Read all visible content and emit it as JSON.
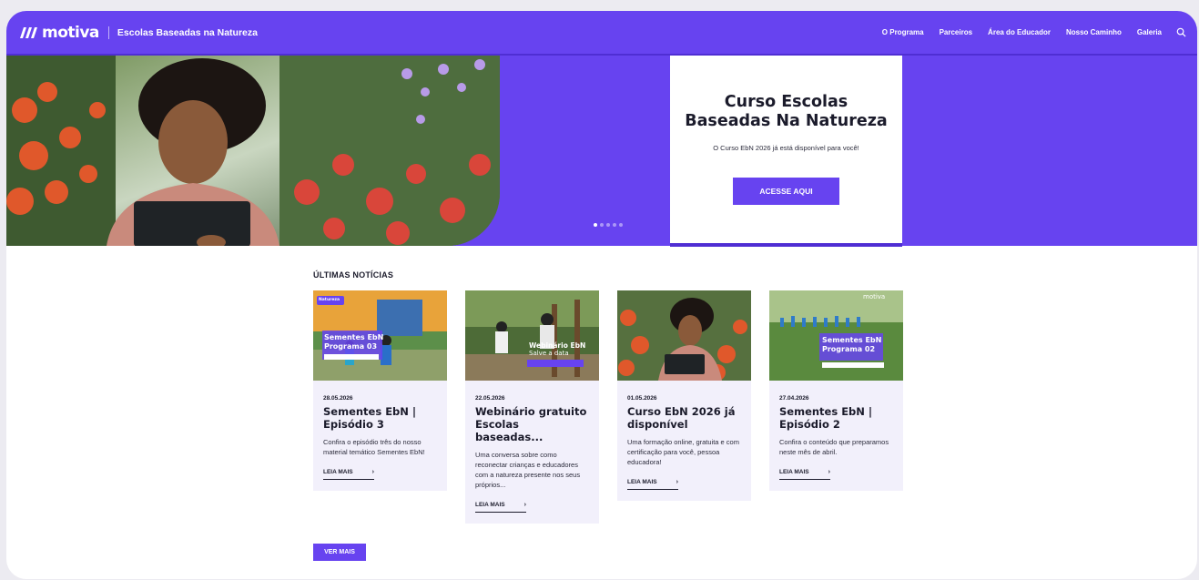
{
  "brand": {
    "logo_text": "motiva",
    "site_name": "Escolas Baseadas na Natureza",
    "accent_color": "#6743f0"
  },
  "nav": {
    "items": [
      {
        "label": "O Programa"
      },
      {
        "label": "Parceiros"
      },
      {
        "label": "Área do Educador"
      },
      {
        "label": "Nosso Caminho"
      },
      {
        "label": "Galeria"
      }
    ],
    "search_icon": "search-icon"
  },
  "hero": {
    "title": "Curso Escolas Baseadas Na Natureza",
    "subtitle": "O Curso EbN 2026 já está disponível para você!",
    "cta_label": "ACESSE AQUI",
    "slide_count": 5,
    "active_slide": 1
  },
  "news": {
    "heading_bold": "ÚLTIMAS",
    "heading_rest": " NOTÍCIAS",
    "items": [
      {
        "date": "28.05.2026",
        "title": "Sementes EbN | Episódio 3",
        "excerpt": "Confira o episódio três do nosso material temático Sementes EbN!",
        "more_label": "LEIA MAIS",
        "image_text": {
          "tag": "Natureza",
          "line1": "Sementes EbN",
          "line2": "Programa 03"
        }
      },
      {
        "date": "22.05.2026",
        "title": "Webinário gratuito Escolas baseadas...",
        "excerpt": "Uma conversa sobre como reconectar crianças e educadores com a natureza presente nos seus próprios...",
        "more_label": "LEIA MAIS",
        "image_text": {
          "line1": "Webinário EbN",
          "line2": "Salve a data"
        }
      },
      {
        "date": "01.05.2026",
        "title": "Curso EbN 2026 já disponível",
        "excerpt": "Uma formação online, gratuita e com certificação para você, pessoa educadora!",
        "more_label": "LEIA MAIS",
        "image_text": {}
      },
      {
        "date": "27.04.2026",
        "title": "Sementes EbN | Episódio 2",
        "excerpt": "Confira o conteúdo que preparamos neste mês de abril.",
        "more_label": "LEIA MAIS",
        "image_text": {
          "logo": "motiva",
          "line1": "Sementes EbN",
          "line2": "Programa 02"
        }
      }
    ],
    "more_button": "VER MAIS"
  }
}
